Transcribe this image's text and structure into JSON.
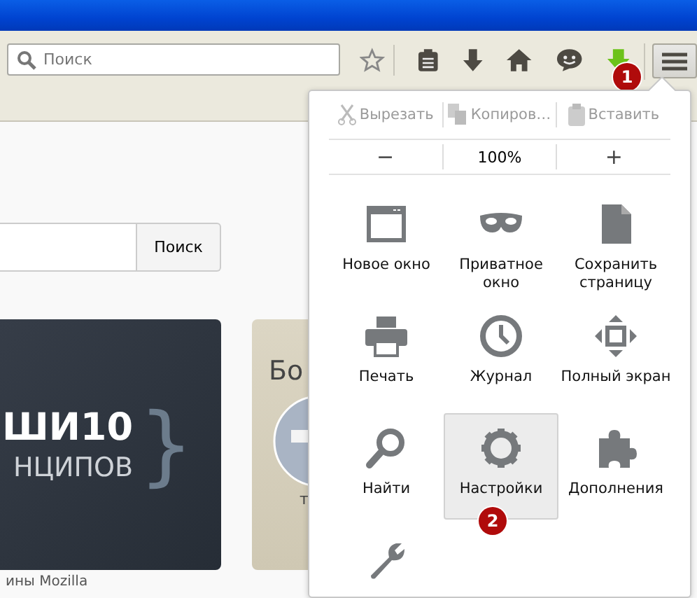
{
  "toolbar": {
    "search": {
      "placeholder": "Поиск"
    },
    "badge": "1"
  },
  "page": {
    "search_button": "Поиск",
    "card_title": "ШИ10",
    "card_subtitle": "НЦИПОВ",
    "card_brace": "}",
    "side_card_title": "Бо",
    "side_card_caption": "т",
    "footer_text": "ины Mozilla"
  },
  "menu": {
    "edit": [
      {
        "label": "Вырезать",
        "disabled": true
      },
      {
        "label": "Копиров…",
        "disabled": true
      },
      {
        "label": "Вставить",
        "disabled": true
      }
    ],
    "zoom": {
      "out": "−",
      "level": "100%",
      "in": "+"
    },
    "items": [
      {
        "label": "Новое окно",
        "selected": false
      },
      {
        "label": "Приватное окно",
        "selected": false
      },
      {
        "label": "Сохранить страницу",
        "selected": false
      },
      {
        "label": "Печать",
        "selected": false
      },
      {
        "label": "Журнал",
        "selected": false
      },
      {
        "label": "Полный экран",
        "selected": false
      },
      {
        "label": "Найти",
        "selected": false
      },
      {
        "label": "Настройки",
        "selected": true,
        "badge": "2"
      },
      {
        "label": "Дополнения",
        "selected": false
      },
      {
        "selected": false
      }
    ]
  }
}
